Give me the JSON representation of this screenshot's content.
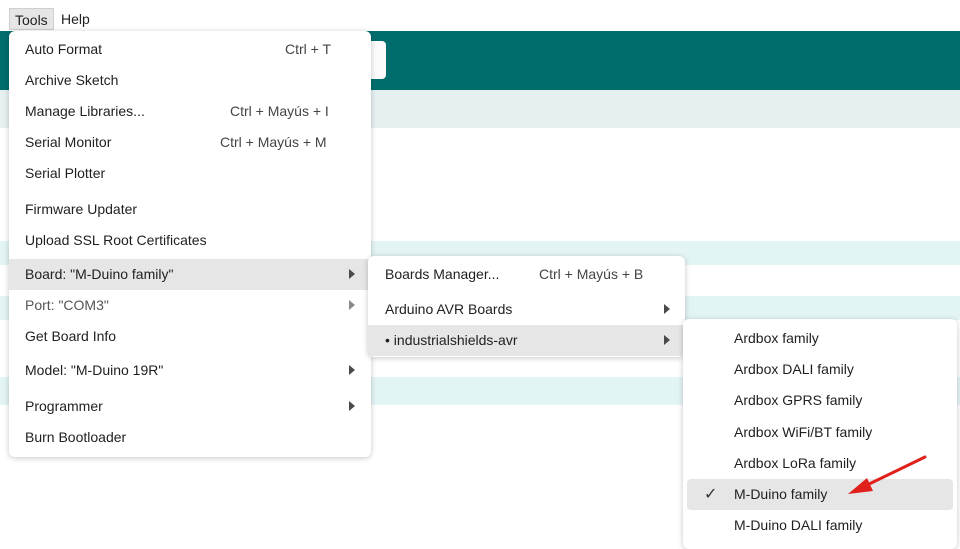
{
  "menubar": {
    "items": [
      "Tools",
      "Help"
    ]
  },
  "tools_menu": {
    "items": [
      {
        "label": "Auto Format",
        "shortcut": "Ctrl + T"
      },
      {
        "label": "Archive Sketch",
        "shortcut": ""
      },
      {
        "label": "Manage Libraries...",
        "shortcut": "Ctrl + Mayús + I"
      },
      {
        "label": "Serial Monitor",
        "shortcut": "Ctrl + Mayús + M"
      },
      {
        "label": "Serial Plotter",
        "shortcut": ""
      },
      {
        "label": "Firmware Updater",
        "shortcut": ""
      },
      {
        "label": "Upload SSL Root Certificates",
        "shortcut": ""
      },
      {
        "label": "Board: \"M-Duino family\"",
        "shortcut": ""
      },
      {
        "label": "Port: \"COM3\"",
        "shortcut": ""
      },
      {
        "label": "Get Board Info",
        "shortcut": ""
      },
      {
        "label": "Model: \"M-Duino 19R\"",
        "shortcut": ""
      },
      {
        "label": "Programmer",
        "shortcut": ""
      },
      {
        "label": "Burn Bootloader",
        "shortcut": ""
      }
    ]
  },
  "board_submenu": {
    "items": [
      {
        "label": "Boards Manager...",
        "shortcut": "Ctrl + Mayús + B"
      },
      {
        "label": "Arduino AVR Boards",
        "shortcut": ""
      },
      {
        "label": "• industrialshields-avr",
        "shortcut": ""
      }
    ]
  },
  "family_submenu": {
    "check": "✓",
    "items": [
      {
        "label": "Ardbox family"
      },
      {
        "label": "Ardbox DALI family"
      },
      {
        "label": "Ardbox GPRS family"
      },
      {
        "label": "Ardbox WiFi/BT family"
      },
      {
        "label": "Ardbox LoRa family"
      },
      {
        "label": "M-Duino family"
      },
      {
        "label": "M-Duino DALI family"
      }
    ]
  },
  "colors": {
    "accent_teal": "#006d6d",
    "highlight": "#e6e6e6",
    "annotation_red": "#e0201b"
  }
}
